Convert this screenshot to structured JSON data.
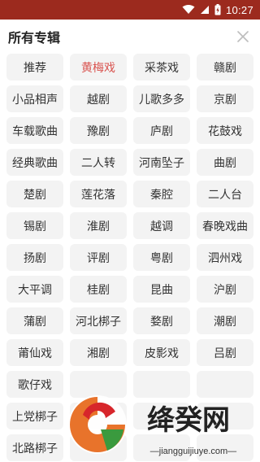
{
  "status_bar": {
    "time": "10:27",
    "background": "#9c2a1e",
    "icons": [
      "wifi-icon",
      "signal-icon",
      "battery-charging-icon"
    ]
  },
  "header": {
    "title": "所有专辑",
    "close_icon": "close-icon"
  },
  "accent_color": "#d9534f",
  "selected_index": 1,
  "albums": [
    "推荐",
    "黄梅戏",
    "采茶戏",
    "赣剧",
    "小品相声",
    "越剧",
    "儿歌多多",
    "京剧",
    "车载歌曲",
    "豫剧",
    "庐剧",
    "花鼓戏",
    "经典歌曲",
    "二人转",
    "河南坠子",
    "曲剧",
    "楚剧",
    "莲花落",
    "秦腔",
    "二人台",
    "锡剧",
    "淮剧",
    "越调",
    "春晚戏曲",
    "扬剧",
    "评剧",
    "粤剧",
    "泗州戏",
    "大平调",
    "桂剧",
    "昆曲",
    "沪剧",
    "蒲剧",
    "河北梆子",
    "婺剧",
    "潮剧",
    "莆仙戏",
    "湘剧",
    "皮影戏",
    "吕剧",
    "歌仔戏",
    "",
    "",
    "",
    "上党梆子",
    "",
    "",
    "",
    "北路梆子",
    "",
    "",
    ""
  ],
  "watermark": {
    "title": "绛癸网",
    "url": "—jiangguijiuye.com—"
  }
}
